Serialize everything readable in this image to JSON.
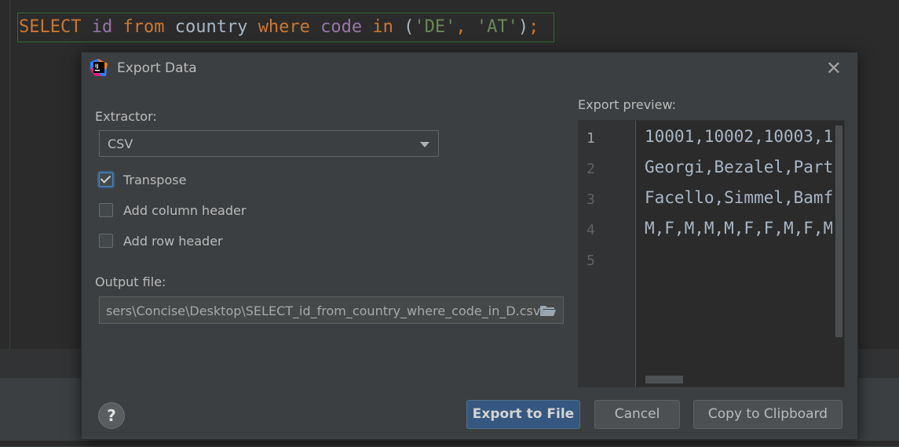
{
  "editor": {
    "sql": [
      {
        "text": "SELECT",
        "cls": "kw"
      },
      {
        "text": " ",
        "cls": ""
      },
      {
        "text": "id",
        "cls": "id"
      },
      {
        "text": " ",
        "cls": ""
      },
      {
        "text": "from",
        "cls": "kw"
      },
      {
        "text": " country ",
        "cls": ""
      },
      {
        "text": "where",
        "cls": "kw"
      },
      {
        "text": " ",
        "cls": ""
      },
      {
        "text": "code",
        "cls": "id"
      },
      {
        "text": " ",
        "cls": ""
      },
      {
        "text": "in",
        "cls": "kw"
      },
      {
        "text": " (",
        "cls": ""
      },
      {
        "text": "'DE'",
        "cls": "str"
      },
      {
        "text": ", ",
        "cls": "kw"
      },
      {
        "text": "'AT'",
        "cls": "str"
      },
      {
        "text": ")",
        "cls": ""
      },
      {
        "text": ";",
        "cls": "kw"
      }
    ]
  },
  "dialog": {
    "title": "Export Data",
    "app_icon": "intellij-app-icon",
    "close_icon": "close-icon",
    "extractor_label": "Extractor:",
    "extractor_value": "CSV",
    "options": [
      {
        "label": "Transpose",
        "checked": true
      },
      {
        "label": "Add column header",
        "checked": false
      },
      {
        "label": "Add row header",
        "checked": false
      }
    ],
    "output_label": "Output file:",
    "output_path": "sers\\Concise\\Desktop\\SELECT_id_from_country_where_code_in_D.csv",
    "preview_label": "Export preview:",
    "preview_lines": [
      {
        "num": "1",
        "text": "10001,10002,10003,1"
      },
      {
        "num": "2",
        "text": "Georgi,Bezalel,Parto"
      },
      {
        "num": "3",
        "text": "Facello,Simmel,Bamfo"
      },
      {
        "num": "4",
        "text": "M,F,M,M,M,F,F,M,F,M"
      },
      {
        "num": "5",
        "text": ""
      }
    ],
    "help_label": "?",
    "buttons": {
      "export": "Export to File",
      "cancel": "Cancel",
      "copy": "Copy to Clipboard"
    }
  },
  "colors": {
    "keyword": "#cc7832",
    "identifier": "#9876aa",
    "string": "#6a8759",
    "primary_button": "#365880"
  }
}
